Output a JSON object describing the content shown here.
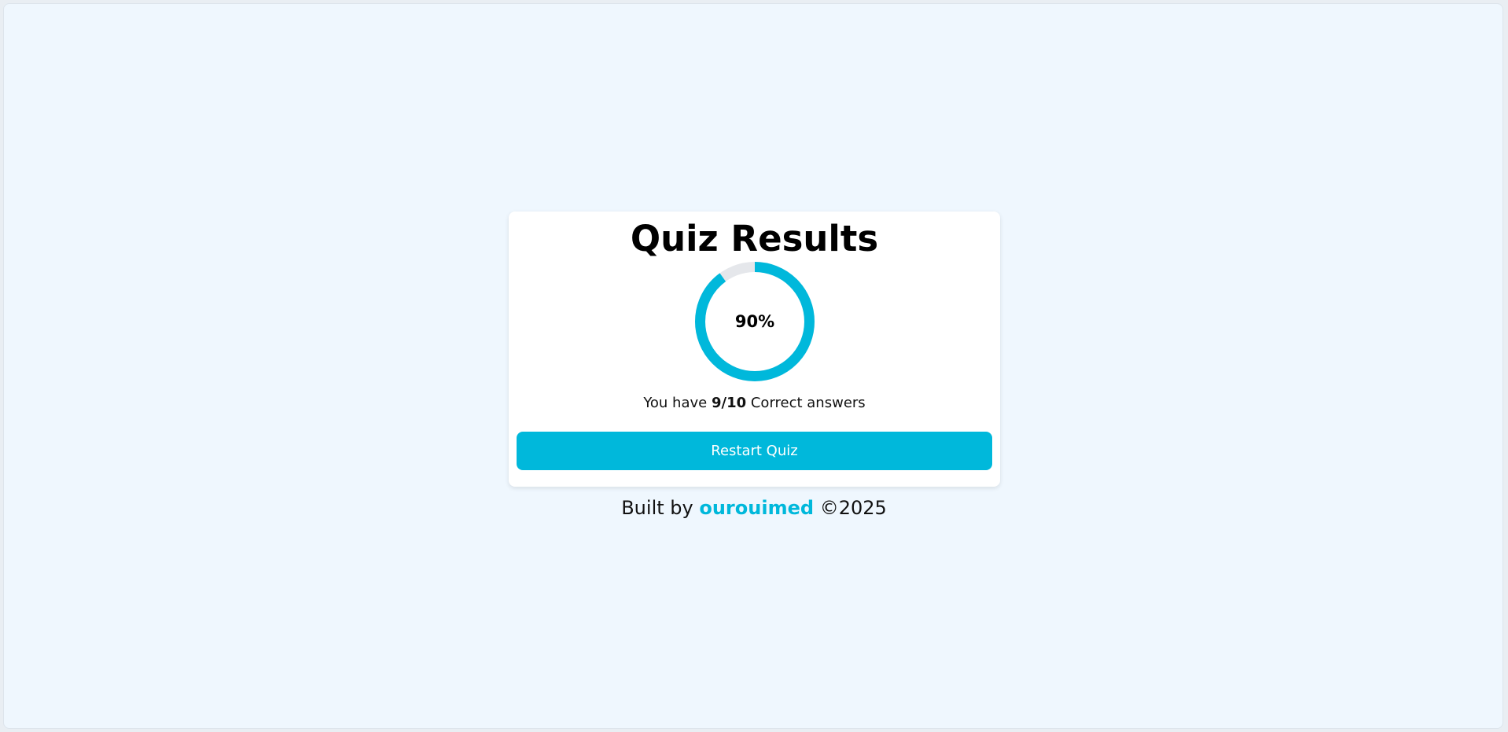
{
  "quiz": {
    "title": "Quiz Results",
    "score_percent_label": "90%",
    "progress_fraction": 0.9,
    "summary_prefix": "You have",
    "score": "9/10",
    "summary_suffix": "Correct answers",
    "restart_label": "Restart Quiz"
  },
  "footer": {
    "prefix": "Built by",
    "author": "ourouimed",
    "suffix": "©2025"
  },
  "colors": {
    "accent": "#00b8db",
    "ring_track": "#e5e7eb",
    "page_background": "#eff7fe"
  }
}
